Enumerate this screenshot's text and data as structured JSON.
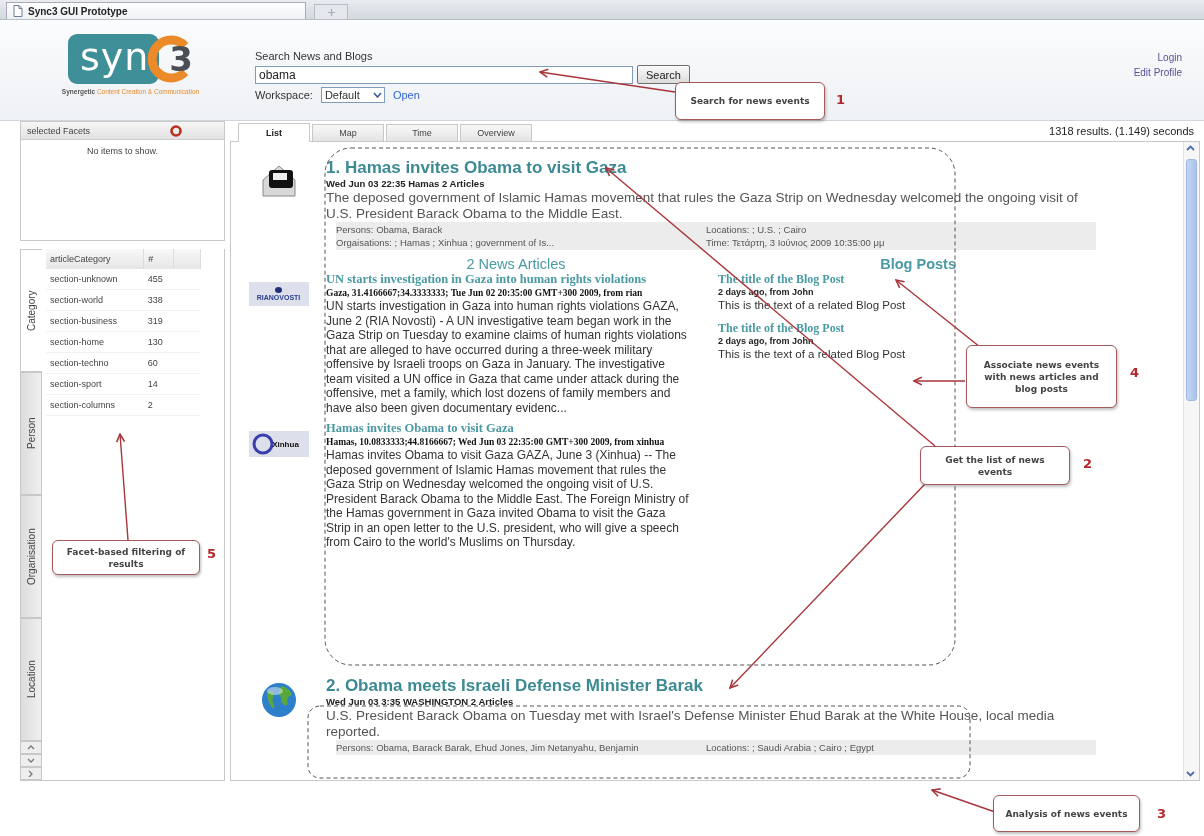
{
  "browser_tab": {
    "title": "Sync3 GUI Prototype"
  },
  "header": {
    "logo": {
      "wordmark": "syn",
      "mark": "3",
      "tagline_lead": "Synergetic",
      "tagline_rest": "Content Creation & Communication"
    },
    "search": {
      "label": "Search News and Blogs",
      "value": "obama",
      "button": "Search"
    },
    "workspace": {
      "label": "Workspace:",
      "value": "Default",
      "link": "Open"
    },
    "user_links": [
      "Login",
      "Edit Profile"
    ]
  },
  "selected_facets": {
    "title": "selected Facets",
    "empty_text": "No items to show."
  },
  "facet_tabs": [
    {
      "label": "Category",
      "selected": true
    },
    {
      "label": "Person",
      "selected": false
    },
    {
      "label": "Organisation",
      "selected": false
    },
    {
      "label": "Location",
      "selected": false
    }
  ],
  "facet_table": {
    "columns": [
      "articleCategory",
      "#"
    ],
    "rows": [
      [
        "section-unknown",
        "455"
      ],
      [
        "section-world",
        "338"
      ],
      [
        "section-business",
        "319"
      ],
      [
        "section-home",
        "130"
      ],
      [
        "section-techno",
        "60"
      ],
      [
        "section-sport",
        "14"
      ],
      [
        "section-columns",
        "2"
      ]
    ]
  },
  "view_tabs": [
    {
      "label": "List",
      "selected": true
    },
    {
      "label": "Map",
      "selected": false
    },
    {
      "label": "Time",
      "selected": false
    },
    {
      "label": "Overview",
      "selected": false
    }
  ],
  "result_summary": "1318 results. (1.149) seconds",
  "events": [
    {
      "kind": "device",
      "title": "1. Hamas invites Obama to visit Gaza",
      "meta": "Wed Jun 03 22:35 Hamas 2 Articles",
      "description": "The deposed government of Islamic Hamas movement that rules the Gaza Strip on Wednesday welcomed the ongoing visit of U.S. President Barack Obama to the Middle East.",
      "facets_left": [
        "Persons: Obama, Barack",
        "Orgaisations: ; Hamas ; Xinhua ; government of Is..."
      ],
      "facets_right": [
        "Locations: ; U.S. ; Cairo",
        "Time: Τετάρτη, 3 Ιούνιος 2009 10:35:00 μμ"
      ],
      "articles_heading": "2 News Articles",
      "blogs_heading": "Blog Posts",
      "articles": [
        {
          "source_logo": {
            "kind": "dot",
            "text": "RIANOVOSTI"
          },
          "title": "UN starts investigation in Gaza into human rights violations",
          "meta": "Gaza, 31.4166667;34.3333333; Tue Jun 02 20:35:00 GMT+300 2009, from rian",
          "text": "UN starts investigation in Gaza into human rights violations GAZA, June 2 (RIA Novosti) - A UN investigative team began work in the Gaza Strip on Tuesday to examine claims of human rights violations that are alleged to have occurred during a three-week military offensive by Israeli troops on Gaza in January. The investigative team visited a UN office in Gaza that came under attack during the offensive, met a family, which lost dozens of family members and have also been given documentary evidenc..."
        },
        {
          "source_logo": {
            "kind": "ring",
            "text": "Xinhua"
          },
          "title": "Hamas invites Obama to visit Gaza",
          "meta": "Hamas, 10.0833333;44.8166667; Wed Jun 03 22:35:00 GMT+300 2009, from xinhua",
          "text": "Hamas invites Obama to visit Gaza GAZA, June 3 (Xinhua) -- The deposed government of Islamic Hamas movement that rules the Gaza Strip on Wednesday welcomed the ongoing visit of U.S. President Barack Obama to the Middle East. The Foreign Ministry of the Hamas government in Gaza invited Obama to visit the Gaza Strip in an open letter to the U.S. president, who will give a speech from Cairo to the world's Muslims on Thursday."
        }
      ],
      "blog_posts": [
        {
          "title": "The title of the Blog Post",
          "meta": "2 days ago, from John",
          "text": "This is the text of a related Blog Post"
        },
        {
          "title": "The title of the Blog Post",
          "meta": "2 days ago, from John",
          "text": "This is the text of a related Blog Post"
        }
      ]
    },
    {
      "kind": "globe",
      "title": "2. Obama meets Israeli Defense Minister Barak",
      "meta": "Wed Jun 03 3:35 WASHINGTON 2 Articles",
      "description": "U.S. President Barack Obama on Tuesday met with Israel's Defense Minister Ehud Barak at the White House, local media reported.",
      "facets_left": [
        "Persons: Obama, Barack Barak, Ehud Jones, Jim Netanyahu, Benjamin"
      ],
      "facets_right": [
        "Locations: ; Saudi Arabia ; Cairo ; Egypt"
      ]
    }
  ],
  "annotations": [
    {
      "number": "1",
      "text": "Search for news events"
    },
    {
      "number": "4",
      "text": "Associate news events with news articles and blog posts"
    },
    {
      "number": "2",
      "text": "Get the list of news events"
    },
    {
      "number": "5",
      "text": "Facet-based filtering of results"
    },
    {
      "number": "3",
      "text": "Analysis of news events"
    }
  ]
}
